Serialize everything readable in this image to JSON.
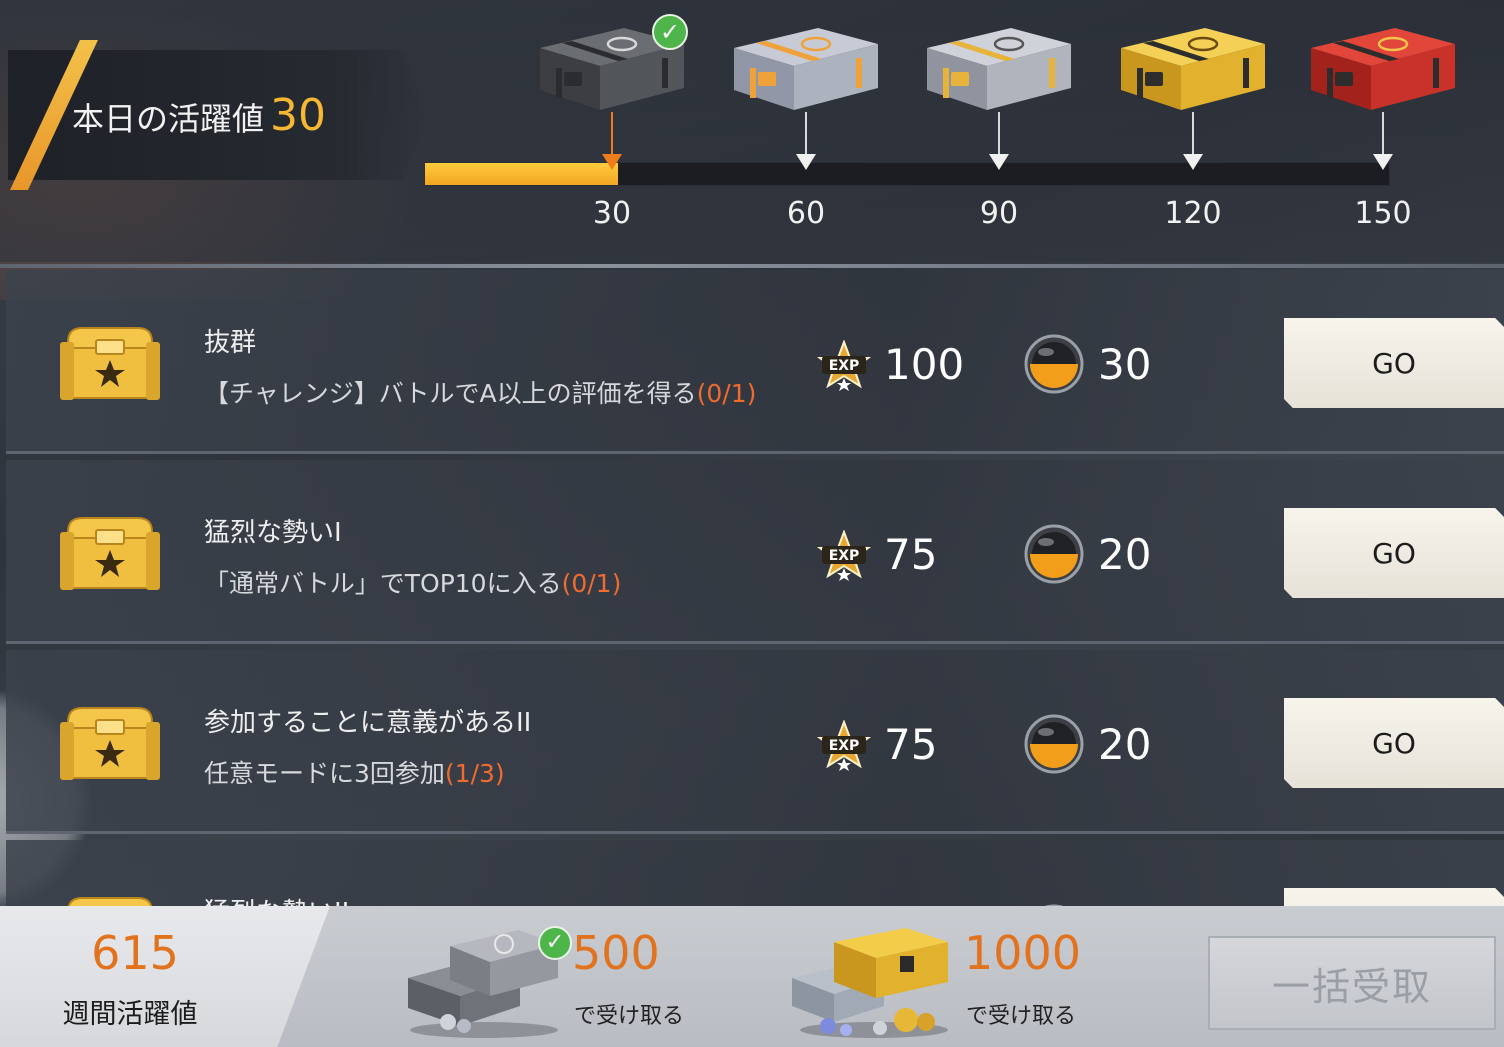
{
  "daily": {
    "label": "本日の活躍値",
    "value": "30",
    "progress": 0.2
  },
  "milestones": [
    {
      "label": "30",
      "chest": "gray-crate",
      "claimed": true,
      "reached": true
    },
    {
      "label": "60",
      "chest": "silver-crate",
      "claimed": false,
      "reached": false
    },
    {
      "label": "90",
      "chest": "silver-gold-crate",
      "claimed": false,
      "reached": false
    },
    {
      "label": "120",
      "chest": "gold-crate",
      "claimed": false,
      "reached": false
    },
    {
      "label": "150",
      "chest": "red-crate",
      "claimed": false,
      "reached": false
    }
  ],
  "tasks": [
    {
      "title": "抜群",
      "desc": "【チャレンジ】バトルでA以上の評価を得る",
      "progress": "(0/1)",
      "exp": "100",
      "coin": "30",
      "button": "GO"
    },
    {
      "title": "猛烈な勢いI",
      "desc": "「通常バトル」でTOP10に入る",
      "progress": "(0/1)",
      "exp": "75",
      "coin": "20",
      "button": "GO"
    },
    {
      "title": "参加することに意義があるII",
      "desc": "任意モードに3回参加",
      "progress": "(1/3)",
      "exp": "75",
      "coin": "20",
      "button": "GO"
    },
    {
      "title": "猛烈な勢いII",
      "desc": "",
      "progress": "",
      "exp": "",
      "coin": "",
      "button": ""
    }
  ],
  "weekly": {
    "value": "615",
    "label": "週間活躍値",
    "rewards": [
      {
        "threshold": "500",
        "sub": "で受け取る",
        "claimed": true,
        "chest": "gray-chest-stack"
      },
      {
        "threshold": "1000",
        "sub": "で受け取る",
        "claimed": false,
        "chest": "gold-chest-stack"
      }
    ]
  },
  "bulk_button": "一括受取",
  "colors": {
    "accent": "#f7b733",
    "progress": "#ef6b2e",
    "weekly": "#e2731e",
    "check": "#4db549"
  }
}
